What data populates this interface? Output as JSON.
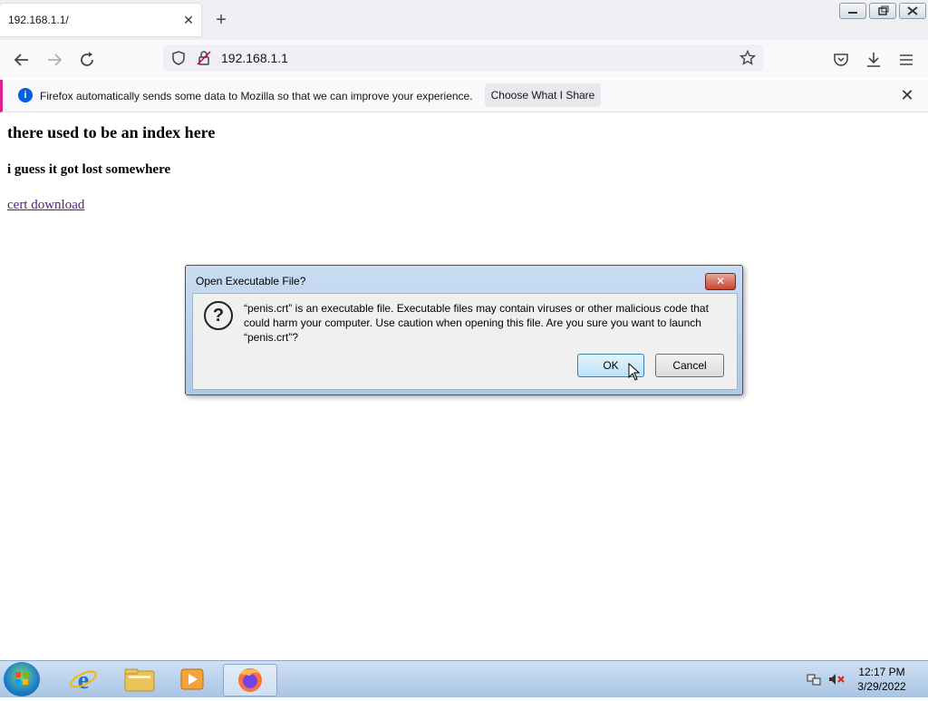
{
  "browser": {
    "tab_title": "192.168.1.1/",
    "url": "192.168.1.1",
    "notification": {
      "text": "Firefox automatically sends some data to Mozilla so that we can improve your experience.",
      "button": "Choose What I Share"
    }
  },
  "page": {
    "heading": "there used to be an index here",
    "subheading": "i guess it got lost somewhere",
    "link": "cert download"
  },
  "dialog": {
    "title": "Open Executable File?",
    "message": "“penis.crt” is an executable file. Executable files may contain viruses or other malicious code that could harm your computer. Use caution when opening this file. Are you sure you want to launch “penis.crt”?",
    "ok_label": "OK",
    "cancel_label": "Cancel"
  },
  "taskbar": {
    "time": "12:17 PM",
    "date": "3/29/2022"
  },
  "icons": {
    "back": "arrow-left-icon",
    "forward": "arrow-right-icon",
    "reload": "reload-icon",
    "bookmark": "star-icon",
    "pocket": "pocket-icon",
    "downloads": "download-icon",
    "menu": "hamburger-menu-icon"
  }
}
